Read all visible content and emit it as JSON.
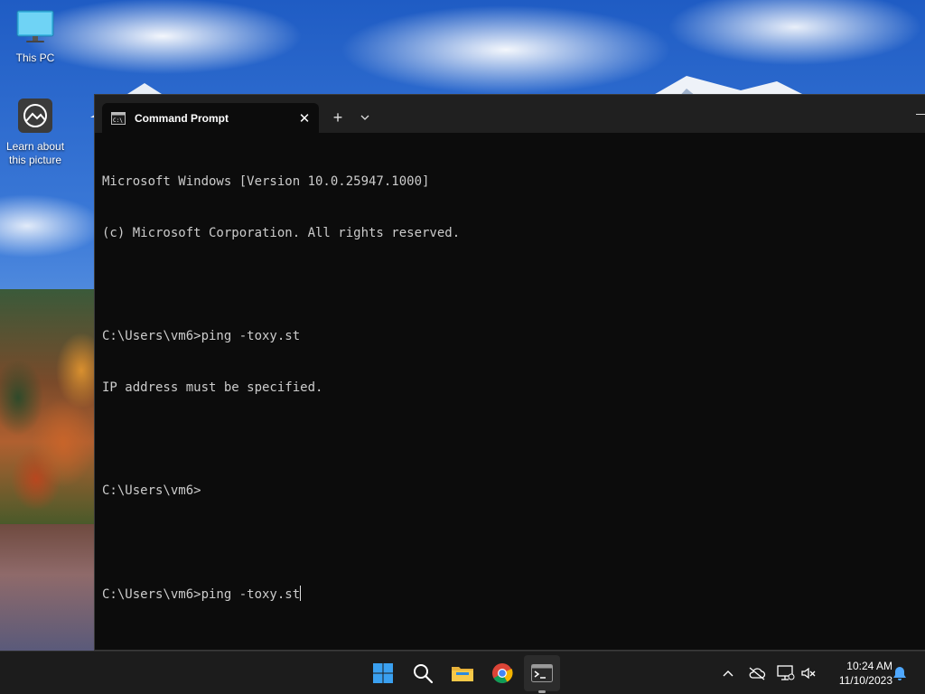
{
  "desktop": {
    "icons": [
      {
        "label": "This PC"
      },
      {
        "label_line1": "Learn about",
        "label_line2": "this picture"
      }
    ]
  },
  "terminal": {
    "tab_title": "Command Prompt",
    "tab_icon": "cmd-icon",
    "close_glyph": "✕",
    "new_tab_glyph": "+",
    "lines": [
      "Microsoft Windows [Version 10.0.25947.1000]",
      "(c) Microsoft Corporation. All rights reserved.",
      "",
      "C:\\Users\\vm6>ping -toxy.st",
      "IP address must be specified.",
      "",
      "C:\\Users\\vm6>",
      "",
      "C:\\Users\\vm6>ping -toxy.st"
    ]
  },
  "taskbar": {
    "apps": [
      "start-icon",
      "search-icon",
      "file-explorer-icon",
      "chrome-icon",
      "terminal-icon"
    ],
    "clock": {
      "time": "10:24 AM",
      "date": "11/10/2023"
    },
    "tray": [
      "chevron-up-icon",
      "cloud-offline-icon",
      "network-icon",
      "volume-muted-icon",
      "notification-bell-icon"
    ]
  },
  "colors": {
    "console_bg": "#0c0c0c",
    "console_text": "#cccccc",
    "titlebar_bg": "#202020",
    "taskbar_bg": "#1c1c1c",
    "accent": "#0078d4"
  }
}
